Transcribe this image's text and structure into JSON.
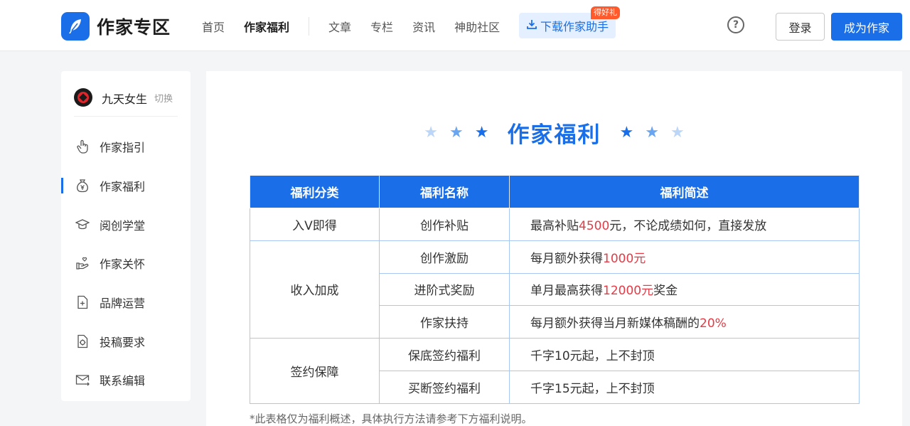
{
  "header": {
    "logo_text": "作家专区",
    "nav": [
      "首页",
      "作家福利",
      "文章",
      "专栏",
      "资讯",
      "神助社区"
    ],
    "download_label": "下载作家助手",
    "gift_badge": "得好礼",
    "login_label": "登录",
    "become_writer_label": "成为作家"
  },
  "sidebar": {
    "site_name": "九天女生",
    "switch_label": "切换",
    "items": [
      {
        "label": "作家指引",
        "icon": "hand-pointer-icon"
      },
      {
        "label": "作家福利",
        "icon": "money-bag-icon"
      },
      {
        "label": "阅创学堂",
        "icon": "graduation-cap-icon"
      },
      {
        "label": "作家关怀",
        "icon": "care-hand-icon"
      },
      {
        "label": "品牌运营",
        "icon": "brand-file-icon"
      },
      {
        "label": "投稿要求",
        "icon": "submit-doc-icon"
      },
      {
        "label": "联系编辑",
        "icon": "mail-icon"
      }
    ],
    "active_index": 1
  },
  "main": {
    "title": "作家福利",
    "table": {
      "headers": [
        "福利分类",
        "福利名称",
        "福利简述"
      ],
      "rows": [
        {
          "category": "入V即得",
          "name": "创作补贴",
          "desc": [
            "最高补贴",
            "4500",
            "元，不论成绩如何，直接发放"
          ]
        },
        {
          "category": "收入加成",
          "name": "创作激励",
          "desc": [
            "每月额外获得",
            "1000元",
            ""
          ]
        },
        {
          "category": "",
          "name": "进阶式奖励",
          "desc": [
            "单月最高获得",
            "12000元",
            "奖金"
          ]
        },
        {
          "category": "",
          "name": "作家扶持",
          "desc": [
            "每月额外获得当月新媒体稿酬的",
            "20%",
            ""
          ]
        },
        {
          "category": "签约保障",
          "name": "保底签约福利",
          "desc": [
            "千字10元起，上不封顶",
            "",
            ""
          ]
        },
        {
          "category": "",
          "name": "买断签约福利",
          "desc": [
            "千字15元起，上不封顶",
            "",
            ""
          ]
        }
      ]
    },
    "note": "*此表格仅为福利概述，具体执行方法请参考下方福利说明。"
  },
  "colors": {
    "accent": "#1a6fe8",
    "highlight": "#e43b46",
    "badge": "#ff5a2c"
  }
}
